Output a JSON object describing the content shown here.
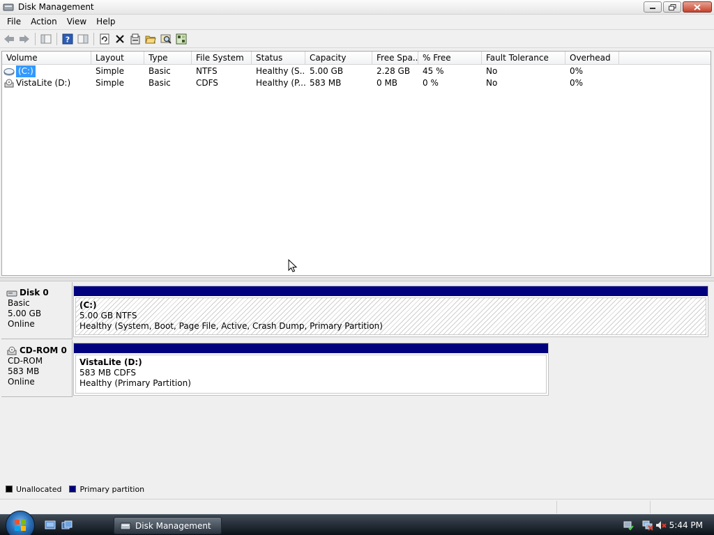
{
  "window": {
    "title": "Disk Management"
  },
  "menu": [
    "File",
    "Action",
    "View",
    "Help"
  ],
  "toolbar": [
    "back-icon",
    "forward-icon",
    "console-tree-icon",
    "help-icon",
    "show-hide-icon",
    "refresh-icon",
    "delete-icon",
    "properties-icon",
    "open-icon",
    "explore-icon",
    "rescan-icon"
  ],
  "volume_list": {
    "columns": [
      "Volume",
      "Layout",
      "Type",
      "File System",
      "Status",
      "Capacity",
      "Free Spa...",
      "% Free",
      "Fault Tolerance",
      "Overhead"
    ],
    "rows": [
      {
        "volume": "(C:)",
        "layout": "Simple",
        "type": "Basic",
        "fs": "NTFS",
        "status": "Healthy (S...",
        "capacity": "5.00 GB",
        "free": "2.28 GB",
        "pct_free": "45 %",
        "fault": "No",
        "overhead": "0%"
      },
      {
        "volume": "VistaLite (D:)",
        "layout": "Simple",
        "type": "Basic",
        "fs": "CDFS",
        "status": "Healthy (P...",
        "capacity": "583 MB",
        "free": "0 MB",
        "pct_free": "0 %",
        "fault": "No",
        "overhead": "0%"
      }
    ]
  },
  "disks": [
    {
      "name": "Disk 0",
      "type": "Basic",
      "size": "5.00 GB",
      "state": "Online",
      "partition": {
        "label": "(C:)",
        "detail": "5.00 GB NTFS",
        "status": "Healthy (System, Boot, Page File, Active, Crash Dump, Primary Partition)"
      }
    },
    {
      "name": "CD-ROM 0",
      "type": "CD-ROM",
      "size": "583 MB",
      "state": "Online",
      "partition": {
        "label": "VistaLite  (D:)",
        "detail": "583 MB CDFS",
        "status": "Healthy (Primary Partition)"
      }
    }
  ],
  "legend": [
    {
      "label": "Unallocated",
      "color": "#000000"
    },
    {
      "label": "Primary partition",
      "color": "#00007f"
    }
  ],
  "taskbar": {
    "task_label": "Disk Management",
    "clock": "5:44 PM"
  },
  "colors": {
    "selection": "#3399ff",
    "partition_header": "#00007f"
  }
}
